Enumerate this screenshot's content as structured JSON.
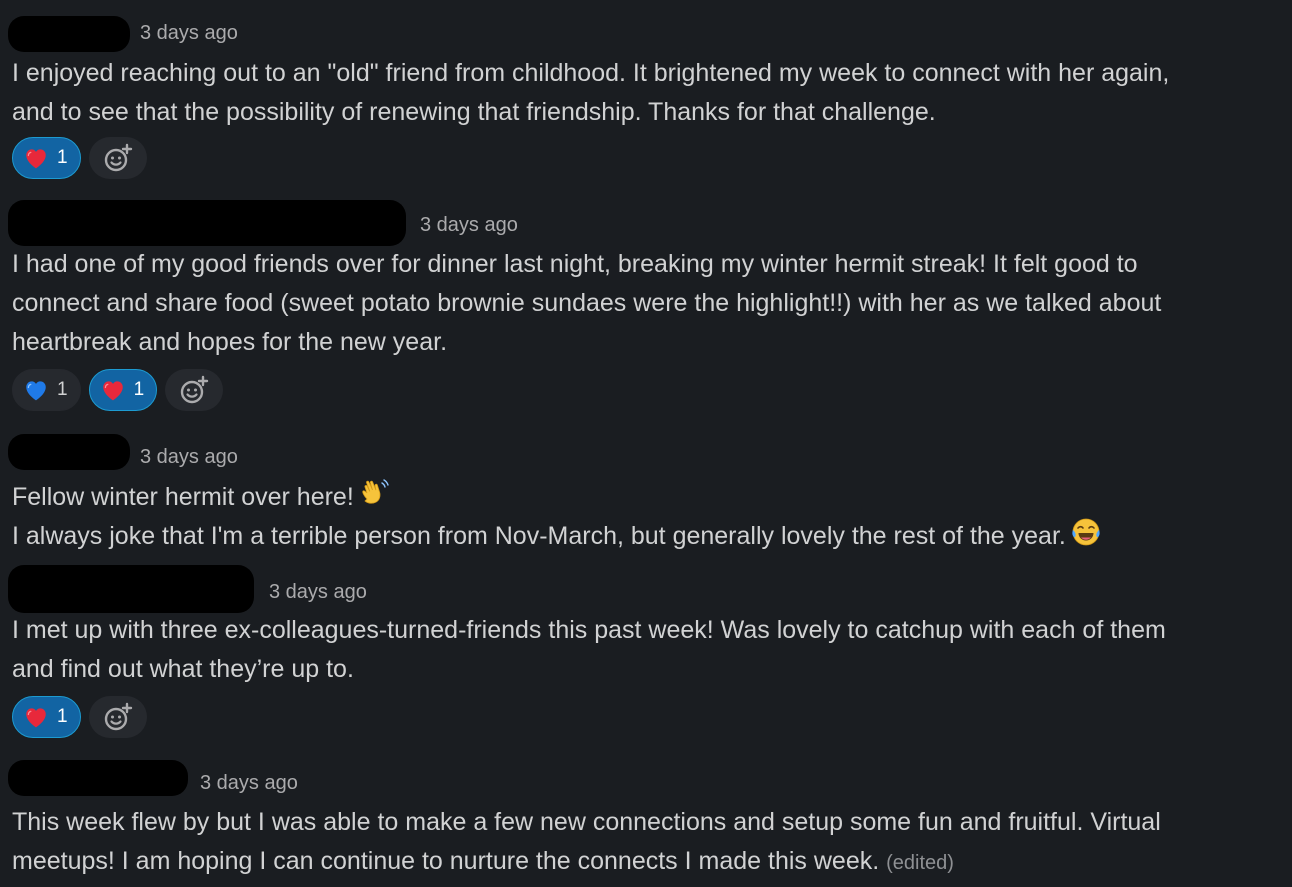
{
  "messages": [
    {
      "timestamp": "3 days ago",
      "lines": [
        "I enjoyed reaching out to an \"old\" friend from childhood. It brightened my week to connect with her again,",
        "and to see that the possibility of renewing that friendship. Thanks for that challenge."
      ],
      "reactions": [
        {
          "emoji": "red-heart",
          "count": "1",
          "active": true
        }
      ]
    },
    {
      "timestamp": "3 days ago",
      "lines": [
        "I had one of my good friends over for dinner last night, breaking my winter hermit streak! It felt good to",
        "connect and share food (sweet potato brownie sundaes were the highlight!!) with her as we talked about",
        "heartbreak and hopes for the new year."
      ],
      "reactions": [
        {
          "emoji": "blue-heart",
          "count": "1",
          "active": false
        },
        {
          "emoji": "red-heart",
          "count": "1",
          "active": true
        }
      ]
    },
    {
      "timestamp": "3 days ago",
      "lines": [
        "Fellow winter hermit over here!",
        "I always joke that I'm a terrible person from Nov-March, but generally lovely the rest of the year."
      ],
      "inline_emojis": [
        "waving-hand-emoji",
        "tears-of-joy-emoji"
      ]
    },
    {
      "timestamp": "3 days ago",
      "lines": [
        "I met up with three ex-colleagues-turned-friends this past week! Was lovely to catchup with each of them",
        "and find out what they’re up to."
      ],
      "reactions": [
        {
          "emoji": "red-heart",
          "count": "1",
          "active": true
        }
      ]
    },
    {
      "timestamp": "3 days ago",
      "lines": [
        "This week flew by but I was able to make a few new connections and setup some fun and fruitful. Virtual",
        "meetups! I am hoping I can continue to nurture the connects I made this week."
      ],
      "edited_label": "(edited)"
    }
  ],
  "icons": {
    "add_reaction": "add-reaction-icon",
    "red_heart": "red-heart-emoji",
    "blue_heart": "blue-heart-emoji"
  },
  "colors": {
    "background": "#1a1d21",
    "text": "#d1d2d3",
    "timestamp": "#ababad",
    "reaction_active": "#1264a3",
    "reaction_border": "#1d9bd1",
    "redaction": "#000000"
  }
}
